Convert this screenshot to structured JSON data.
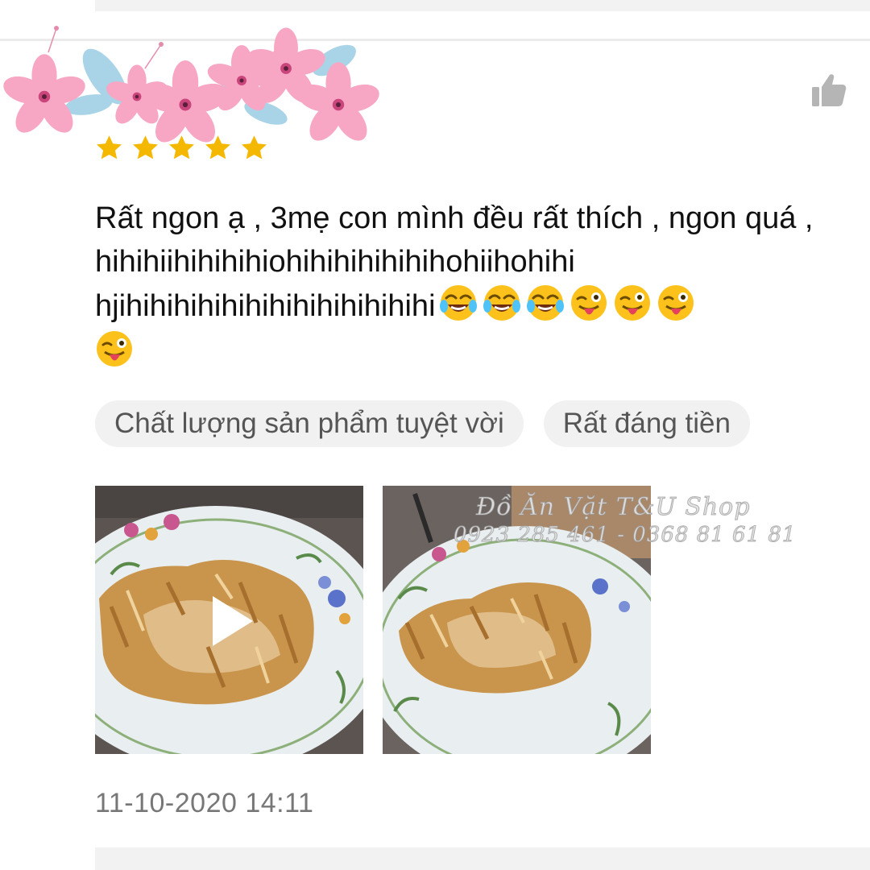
{
  "review": {
    "rating": 5,
    "max_rating": 5,
    "text_main": "Rất ngon ạ , 3mẹ con mình đều rất thích , ngon quá , hihihiihihihihiohihihihihihihohiihohihi hjihihihihihihihihihihihihihi",
    "emojis": [
      "face-with-tears-of-joy",
      "face-with-tears-of-joy",
      "face-with-tears-of-joy",
      "winking-face-with-tongue",
      "winking-face-with-tongue",
      "winking-face-with-tongue",
      "winking-face-with-tongue"
    ],
    "tags": [
      "Chất lượng sản phẩm tuyệt vời",
      "Rất đáng tiền"
    ],
    "timestamp": "11-10-2020 14:11"
  },
  "media": [
    {
      "kind": "video",
      "subject": "pork floss sticky rice on floral plate"
    },
    {
      "kind": "image",
      "subject": "pork floss sticky rice on floral plate"
    }
  ],
  "watermark": {
    "line1": "Đồ Ăn Vặt T&U Shop",
    "line2": "0923 285 461 - 0368 81 61 81"
  },
  "icons": {
    "like": "thumbs-up-icon",
    "star": "star-icon",
    "play": "play-icon"
  },
  "colors": {
    "star": "#f5b800",
    "like_icon": "#b5b5b5",
    "tag_bg": "#f1f1f1",
    "tag_text": "#555555",
    "timestamp": "#777777"
  }
}
